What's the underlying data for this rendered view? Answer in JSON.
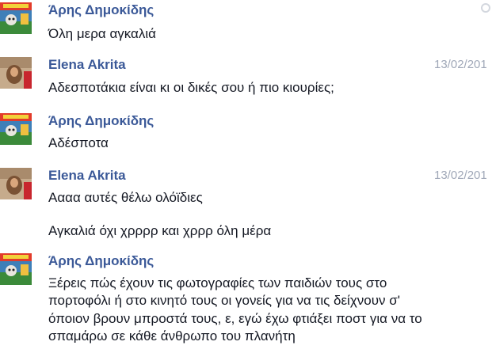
{
  "messages": [
    {
      "sender": "Άρης Δημοκίδης",
      "date": "",
      "avatar": "aris-avatar",
      "lines": [
        "Όλη μερα αγκαλιά"
      ]
    },
    {
      "sender": "Elena Akrita",
      "date": "13/02/201",
      "avatar": "elena-avatar",
      "lines": [
        "Αδεσποτάκια είναι κι οι δικές σου ή πιο κιουρίες;"
      ]
    },
    {
      "sender": "Άρης Δημοκίδης",
      "date": "",
      "avatar": "aris-avatar",
      "lines": [
        "Αδέσποτα"
      ]
    },
    {
      "sender": "Elena Akrita",
      "date": "13/02/201",
      "avatar": "elena-avatar",
      "lines": [
        "Αααα αυτές θέλω ολόϊδιες",
        "Αγκαλιά όχι χρρρρ και χρρρ όλη μέρα"
      ]
    },
    {
      "sender": "Άρης Δημοκίδης",
      "date": "",
      "avatar": "aris-avatar",
      "lines": [
        "Ξέρεις πώς έχουν τις φωτογραφίες των παιδιών τους στο",
        "πορτοφόλι ή στο κινητό τους οι γονείς για να τις δείχνουν σ'",
        "όποιον βρουν μπροστά τους, ε, εγώ έχω φτιάξει ποστ για να το",
        "σπαμάρω σε κάθε άνθρωπο του πλανήτη"
      ]
    }
  ]
}
